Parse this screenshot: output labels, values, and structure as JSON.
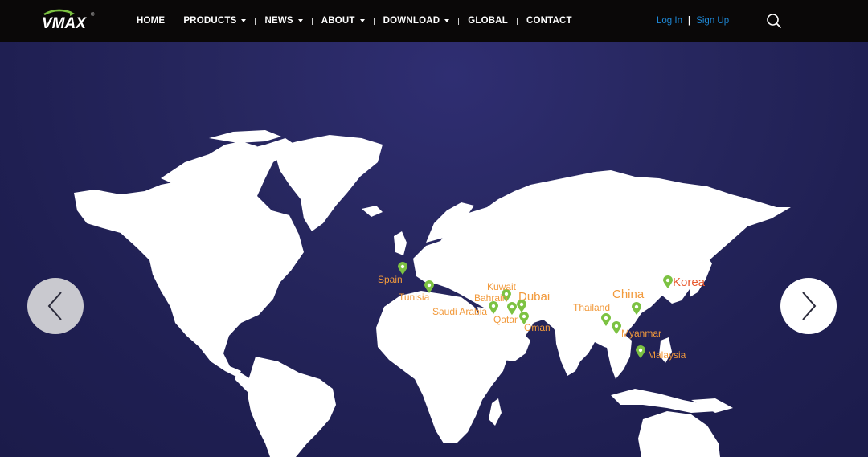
{
  "brand": {
    "logo_text": "VMAX",
    "accent": "#7cc242"
  },
  "nav": {
    "items": [
      {
        "label": "HOME",
        "dropdown": false
      },
      {
        "label": "PRODUCTS",
        "dropdown": true
      },
      {
        "label": "NEWS",
        "dropdown": true
      },
      {
        "label": "ABOUT",
        "dropdown": true
      },
      {
        "label": "DOWNLOAD",
        "dropdown": true
      },
      {
        "label": "GLOBAL",
        "dropdown": false
      },
      {
        "label": "CONTACT",
        "dropdown": false
      }
    ]
  },
  "auth": {
    "login": "Log In",
    "divider": "|",
    "signup": "Sign Up"
  },
  "search": {
    "icon": "search-icon"
  },
  "map": {
    "pin_color": "#7cc242",
    "label_color": "#f29a3c",
    "highlight_color": "#e8592f",
    "locations": [
      {
        "name": "Spain"
      },
      {
        "name": "Tunisia"
      },
      {
        "name": "Saudi Arabia"
      },
      {
        "name": "Kuwait"
      },
      {
        "name": "Bahrain"
      },
      {
        "name": "Qatar"
      },
      {
        "name": "Dubai"
      },
      {
        "name": "Oman"
      },
      {
        "name": "Thailand"
      },
      {
        "name": "China"
      },
      {
        "name": "Myanmar"
      },
      {
        "name": "Malaysia"
      },
      {
        "name": "Korea"
      }
    ]
  },
  "carousel": {
    "prev_icon": "chevron-left-icon",
    "next_icon": "chevron-right-icon"
  }
}
